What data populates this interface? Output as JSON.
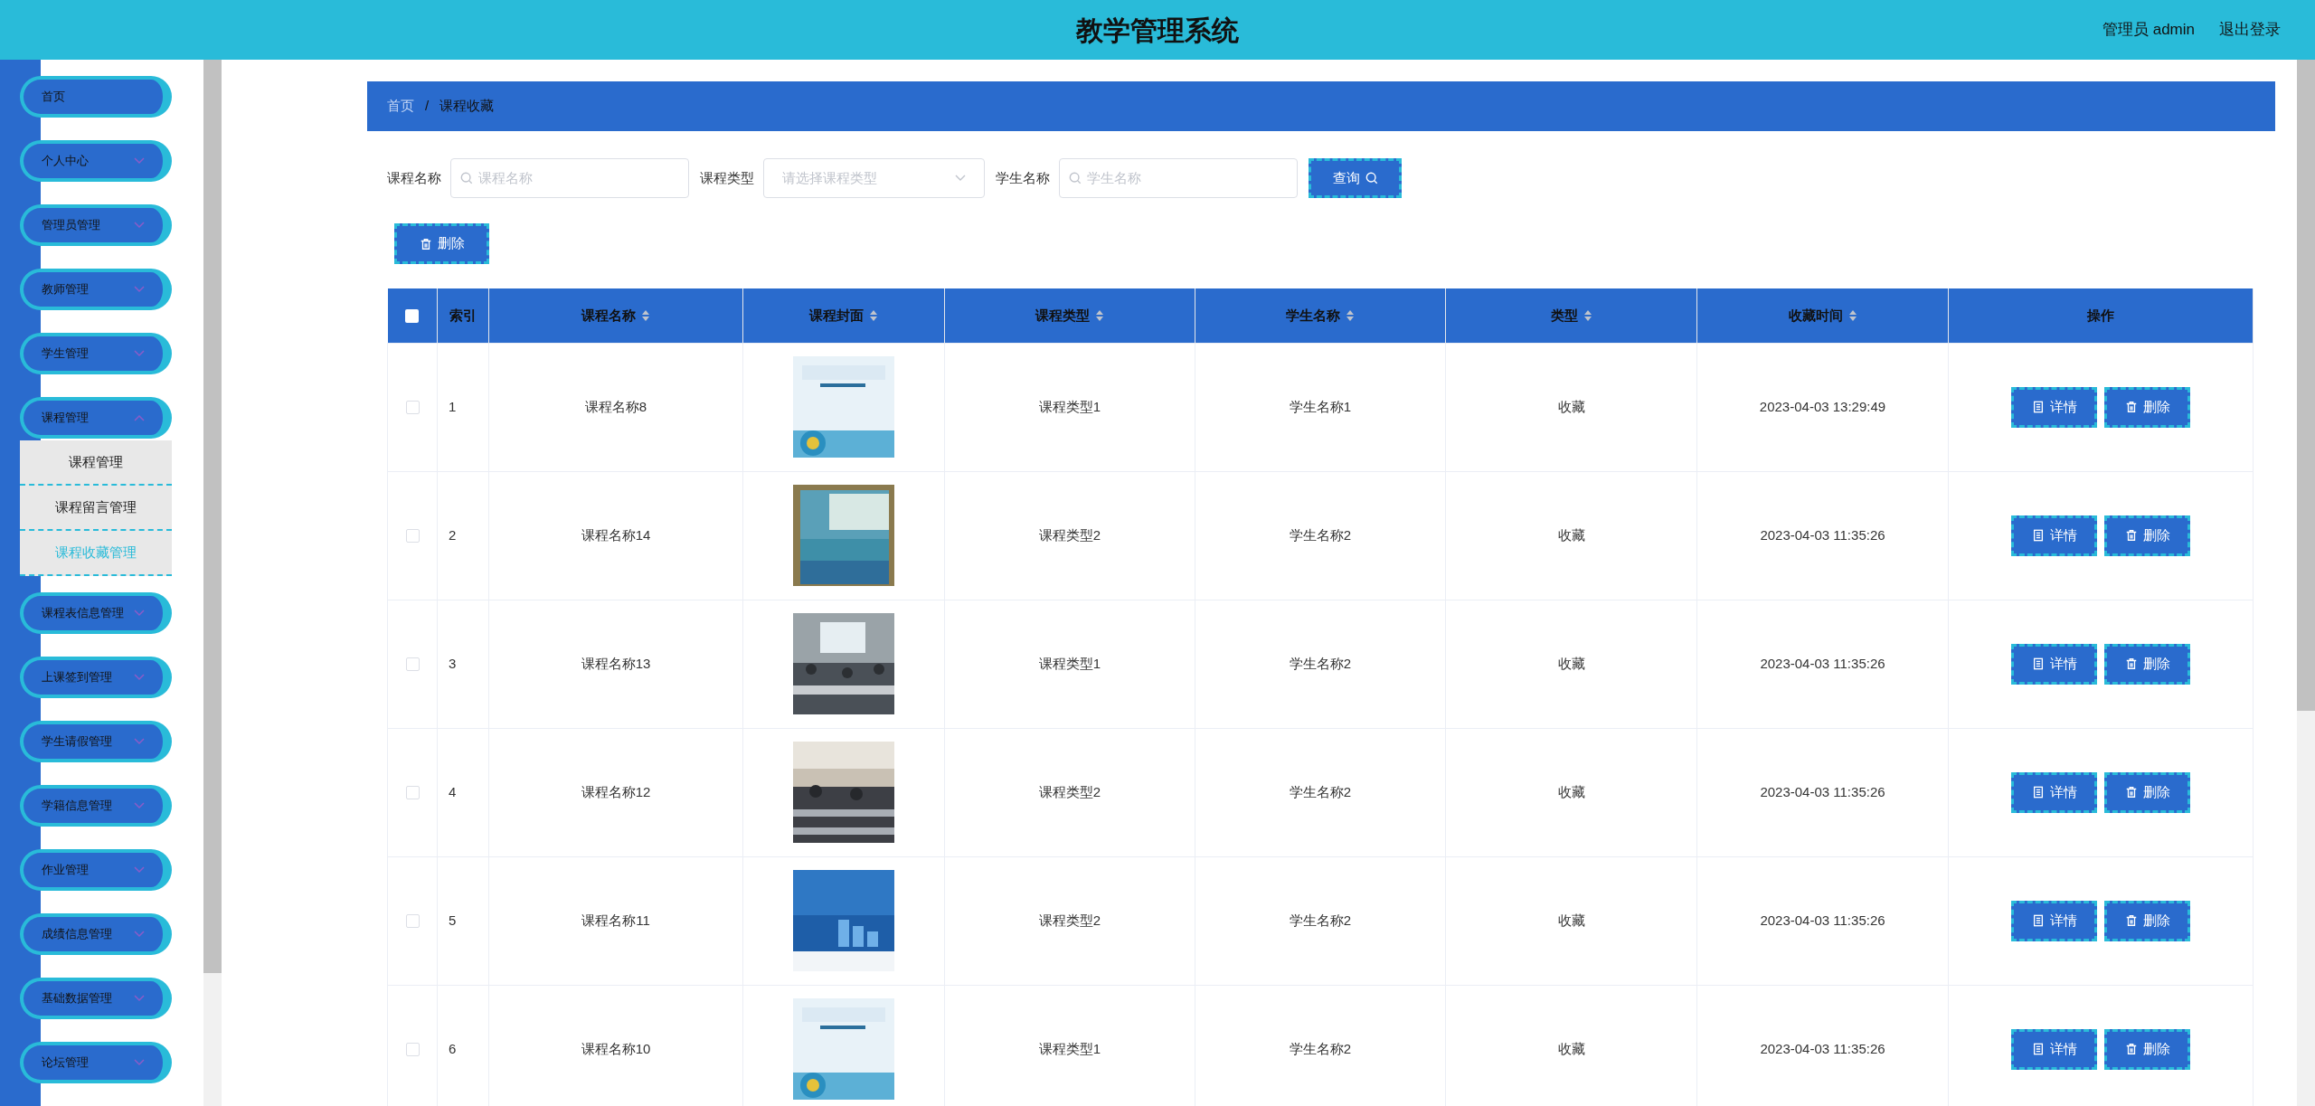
{
  "header": {
    "title": "教学管理系统",
    "user": "管理员 admin",
    "logout": "退出登录"
  },
  "sidebar": {
    "items": [
      {
        "label": "首页",
        "kind": "link",
        "expanded": false
      },
      {
        "label": "个人中心",
        "kind": "menu",
        "expanded": false
      },
      {
        "label": "管理员管理",
        "kind": "menu",
        "expanded": false
      },
      {
        "label": "教师管理",
        "kind": "menu",
        "expanded": false
      },
      {
        "label": "学生管理",
        "kind": "menu",
        "expanded": false
      },
      {
        "label": "课程管理",
        "kind": "menu",
        "expanded": true,
        "children": [
          {
            "label": "课程管理",
            "selected": false
          },
          {
            "label": "课程留言管理",
            "selected": false
          },
          {
            "label": "课程收藏管理",
            "selected": true
          }
        ]
      },
      {
        "label": "课程表信息管理",
        "kind": "menu",
        "expanded": false
      },
      {
        "label": "上课签到管理",
        "kind": "menu",
        "expanded": false
      },
      {
        "label": "学生请假管理",
        "kind": "menu",
        "expanded": false
      },
      {
        "label": "学籍信息管理",
        "kind": "menu",
        "expanded": false
      },
      {
        "label": "作业管理",
        "kind": "menu",
        "expanded": false
      },
      {
        "label": "成绩信息管理",
        "kind": "menu",
        "expanded": false
      },
      {
        "label": "基础数据管理",
        "kind": "menu",
        "expanded": false
      },
      {
        "label": "论坛管理",
        "kind": "menu",
        "expanded": false
      }
    ]
  },
  "breadcrumb": [
    "首页",
    "课程收藏"
  ],
  "breadcrumb_separator": "/",
  "filters": [
    {
      "label": "课程名称",
      "kind": "input",
      "placeholder": "课程名称"
    },
    {
      "label": "课程类型",
      "kind": "select",
      "placeholder": "请选择课程类型"
    },
    {
      "label": "学生名称",
      "kind": "input",
      "placeholder": "学生名称"
    }
  ],
  "search_button": "查询",
  "delete_button": "删除",
  "table": {
    "header_checked": false,
    "columns": [
      {
        "label": "索引",
        "sortable": false
      },
      {
        "label": "课程名称",
        "sortable": true
      },
      {
        "label": "课程封面",
        "sortable": true
      },
      {
        "label": "课程类型",
        "sortable": true
      },
      {
        "label": "学生名称",
        "sortable": true
      },
      {
        "label": "类型",
        "sortable": true
      },
      {
        "label": "收藏时间",
        "sortable": true
      },
      {
        "label": "操作",
        "sortable": false
      }
    ],
    "rows": [
      {
        "checked": false,
        "index": "1",
        "course": "课程名称8",
        "cover": {
          "kind": "picture"
        },
        "course_type": "课程类型1",
        "student": "学生名称1",
        "type": "收藏",
        "time": "2023-04-03 13:29:49",
        "actions": [
          "详情",
          "删除"
        ]
      },
      {
        "checked": false,
        "index": "2",
        "course": "课程名称14",
        "cover": {
          "kind": "picture"
        },
        "course_type": "课程类型2",
        "student": "学生名称2",
        "type": "收藏",
        "time": "2023-04-03 11:35:26",
        "actions": [
          "详情",
          "删除"
        ]
      },
      {
        "checked": false,
        "index": "3",
        "course": "课程名称13",
        "cover": {
          "kind": "picture"
        },
        "course_type": "课程类型1",
        "student": "学生名称2",
        "type": "收藏",
        "time": "2023-04-03 11:35:26",
        "actions": [
          "详情",
          "删除"
        ]
      },
      {
        "checked": false,
        "index": "4",
        "course": "课程名称12",
        "cover": {
          "kind": "picture"
        },
        "course_type": "课程类型2",
        "student": "学生名称2",
        "type": "收藏",
        "time": "2023-04-03 11:35:26",
        "actions": [
          "详情",
          "删除"
        ]
      },
      {
        "checked": false,
        "index": "5",
        "course": "课程名称11",
        "cover": {
          "kind": "picture"
        },
        "course_type": "课程类型2",
        "student": "学生名称2",
        "type": "收藏",
        "time": "2023-04-03 11:35:26",
        "actions": [
          "详情",
          "删除"
        ]
      },
      {
        "checked": false,
        "index": "6",
        "course": "课程名称10",
        "cover": {
          "kind": "picture"
        },
        "course_type": "课程类型1",
        "student": "学生名称2",
        "type": "收藏",
        "time": "2023-04-03 11:35:26",
        "actions": [
          "详情",
          "删除"
        ]
      }
    ]
  }
}
